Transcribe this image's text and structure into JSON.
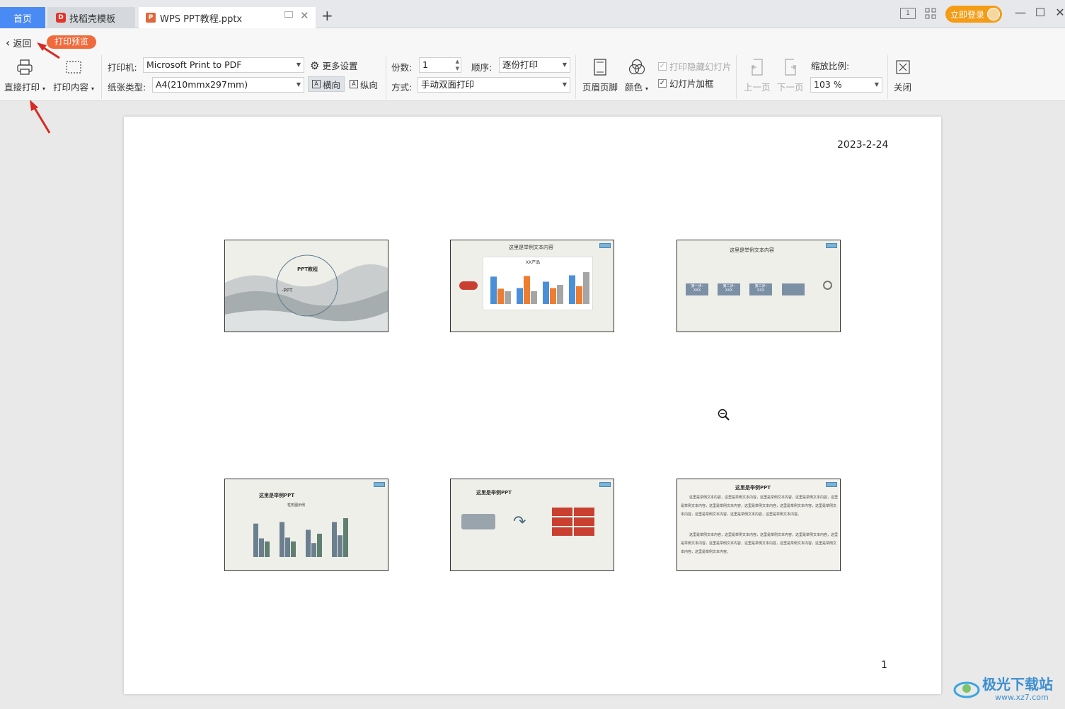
{
  "tabs": {
    "home": "首页",
    "template": "找稻壳模板",
    "document": "WPS PPT教程.pptx",
    "add": "+"
  },
  "titlebar": {
    "login": "立即登录",
    "icon1_text": "1"
  },
  "toolbar": {
    "back": "返回",
    "badge": "打印预览",
    "direct_print": "直接打印",
    "print_content": "打印内容",
    "printer_label": "打印机:",
    "printer_value": "Microsoft Print to PDF",
    "more_settings": "更多设置",
    "paper_label": "纸张类型:",
    "paper_value": "A4(210mmx297mm)",
    "landscape": "横向",
    "portrait": "纵向",
    "copies_label": "份数:",
    "copies_value": "1",
    "order_label": "顺序:",
    "order_value": "逐份打印",
    "mode_label": "方式:",
    "mode_value": "手动双面打印",
    "header_footer": "页眉页脚",
    "color": "颜色",
    "print_hidden": "打印隐藏幻灯片",
    "slide_frame": "幻灯片加框",
    "prev_page": "上一页",
    "next_page": "下一页",
    "zoom_label": "缩放比例:",
    "zoom_value": "103 %",
    "close": "关闭"
  },
  "page": {
    "date": "2023-2-24",
    "number": "1"
  },
  "slides": [
    {
      "title": "PPT教程",
      "subtitle": "-PPT"
    },
    {
      "title": "这里是举例文本内容",
      "chart_title": "XX产品"
    },
    {
      "title": "这里是举例文本内容",
      "step1": "第一步:",
      "step2": "第二步:",
      "step3": "第三步:",
      "xxx": "XXX"
    },
    {
      "title": "这里是举例PPT",
      "chart_title": "柱形图示例"
    },
    {
      "title": "这里是举例PPT"
    },
    {
      "title": "这里是举例PPT",
      "body1": "这里是举例文本内容，这里是举例文本内容，这里是举例文本内容，这里是举例文本内容，这里是举例文本内容，这里是举例文本内容，这里是举例文本内容，这里是举例文本内容，这里是举例文本内容，这里是举例文本内容，这里是举例文本内容，这里是举例文本内容。",
      "body2": "这里是举例文本内容，这里是举例文本内容，这里是举例文本内容，这里是举例文本内容，这里是举例文本内容，这里是举例文本内容，这里是举例文本内容，这里是举例文本内容，这里是举例文本内容，这里是举例文本内容。"
    }
  ],
  "watermark": {
    "text": "极光下载站",
    "url": "www.xz7.com"
  },
  "colors": {
    "accent_blue": "#4a8af4",
    "badge_orange": "#f06a3c",
    "login_orange": "#f49c16",
    "bar_blue": "#4a90d9",
    "bar_orange": "#ed7d31",
    "bar_gray": "#a5a5a5"
  }
}
